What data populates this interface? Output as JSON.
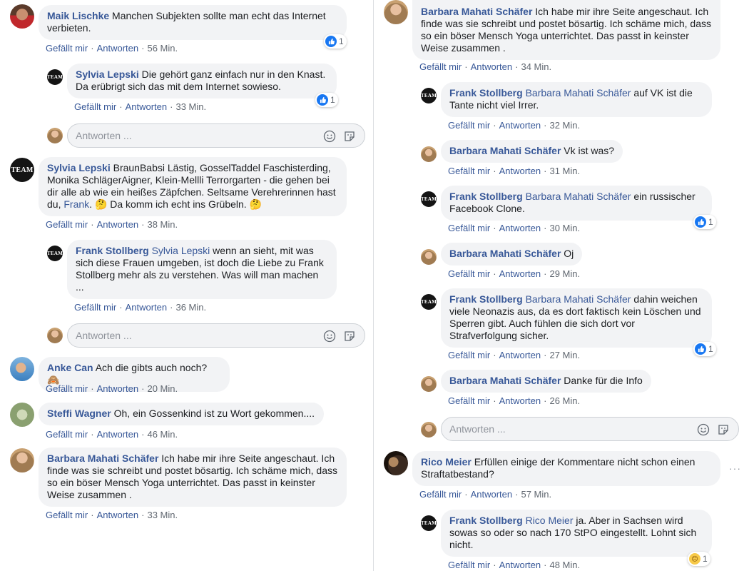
{
  "actions": {
    "like": "Gefällt mir",
    "reply": "Antworten"
  },
  "reply_placeholder": "Antworten ...",
  "left": {
    "c1": {
      "author": "Maik Lischke",
      "text": "Manchen Subjekten sollte man echt das Internet verbieten.",
      "time": "56 Min.",
      "likes": "1"
    },
    "c1r1": {
      "author": "Sylvia Lepski",
      "text": "Die gehört ganz einfach nur in den Knast. Da erübrigt sich das mit dem Internet sowieso.",
      "time": "33 Min.",
      "likes": "1"
    },
    "c2": {
      "author": "Sylvia Lepski",
      "text": "BraunBabsi Lästig, GosselTaddel Faschisterding, Monika SchlägerAigner, Klein-Mellli Terrorgarten - die gehen bei dir alle ab wie ein heißes Zäpfchen. Seltsame Verehrerinnen hast du,",
      "mention": "Frank",
      "text2": ".",
      "text3": "Da komm ich echt ins Grübeln.",
      "time": "38 Min."
    },
    "c2r1": {
      "author": "Frank Stollberg",
      "mention": "Sylvia Lepski",
      "text": "wenn an sieht, mit was sich diese Frauen umgeben, ist doch die Liebe zu Frank Stollberg mehr als zu verstehen. Was will man machen ...",
      "time": "36 Min."
    },
    "c3": {
      "author": "Anke Can",
      "text": "Ach die gibts auch noch?",
      "time": "20 Min."
    },
    "c4": {
      "author": "Steffi Wagner",
      "text": "Oh, ein Gossenkind ist zu Wort gekommen....",
      "time": "46 Min."
    },
    "c5": {
      "author": "Barbara Mahati Schäfer",
      "text": "Ich habe mir ihre Seite angeschaut. Ich finde was sie schreibt und postet bösartig. Ich schäme mich, dass so ein böser Mensch Yoga unterrichtet. Das passt in keinster Weise zusammen .",
      "time": "33 Min."
    }
  },
  "right": {
    "c1": {
      "author": "Barbara Mahati Schäfer",
      "text": "Ich habe mir ihre Seite angeschaut. Ich finde was sie schreibt und postet bösartig. Ich schäme mich, dass so ein böser Mensch Yoga unterrichtet. Das passt in keinster Weise zusammen .",
      "time": "34 Min."
    },
    "r1": {
      "author": "Frank Stollberg",
      "mention": "Barbara Mahati Schäfer",
      "text": "auf VK ist die Tante nicht viel Irrer.",
      "time": "32 Min."
    },
    "r2": {
      "author": "Barbara Mahati Schäfer",
      "text": "Vk ist was?",
      "time": "31 Min."
    },
    "r3": {
      "author": "Frank Stollberg",
      "mention": "Barbara Mahati Schäfer",
      "text": "ein russischer Facebook Clone.",
      "time": "30 Min.",
      "likes": "1"
    },
    "r4": {
      "author": "Barbara Mahati Schäfer",
      "text": "Oj",
      "time": "29 Min."
    },
    "r5": {
      "author": "Frank Stollberg",
      "mention": "Barbara Mahati Schäfer",
      "text": "dahin weichen viele Neonazis aus, da es dort faktisch kein Löschen und Sperren gibt. Auch fühlen die sich dort vor Strafverfolgung sicher.",
      "time": "27 Min.",
      "likes": "1"
    },
    "r6": {
      "author": "Barbara Mahati Schäfer",
      "text": "Danke für die Info",
      "time": "26 Min."
    },
    "c2": {
      "author": "Rico Meier",
      "text": "Erfüllen einige der Kommentare nicht schon einen Straftatbestand?",
      "time": "57 Min."
    },
    "c2r1": {
      "author": "Frank Stollberg",
      "mention": "Rico Meier",
      "text": "ja. Aber in Sachsen wird sowas so oder so nach 170 StPO eingestellt. Lohnt sich nicht.",
      "time": "48 Min.",
      "reactions": "1"
    }
  },
  "avatar_text": "TEAM",
  "icons": {
    "like": "like-icon",
    "sad": "sad-reaction-icon",
    "emoji": "emoji-icon",
    "sticker": "sticker-icon",
    "more": "more-options-icon"
  },
  "colors": {
    "link": "#385898",
    "bubble": "#f2f3f5",
    "meta": "#606770",
    "like": "#1877f2"
  }
}
